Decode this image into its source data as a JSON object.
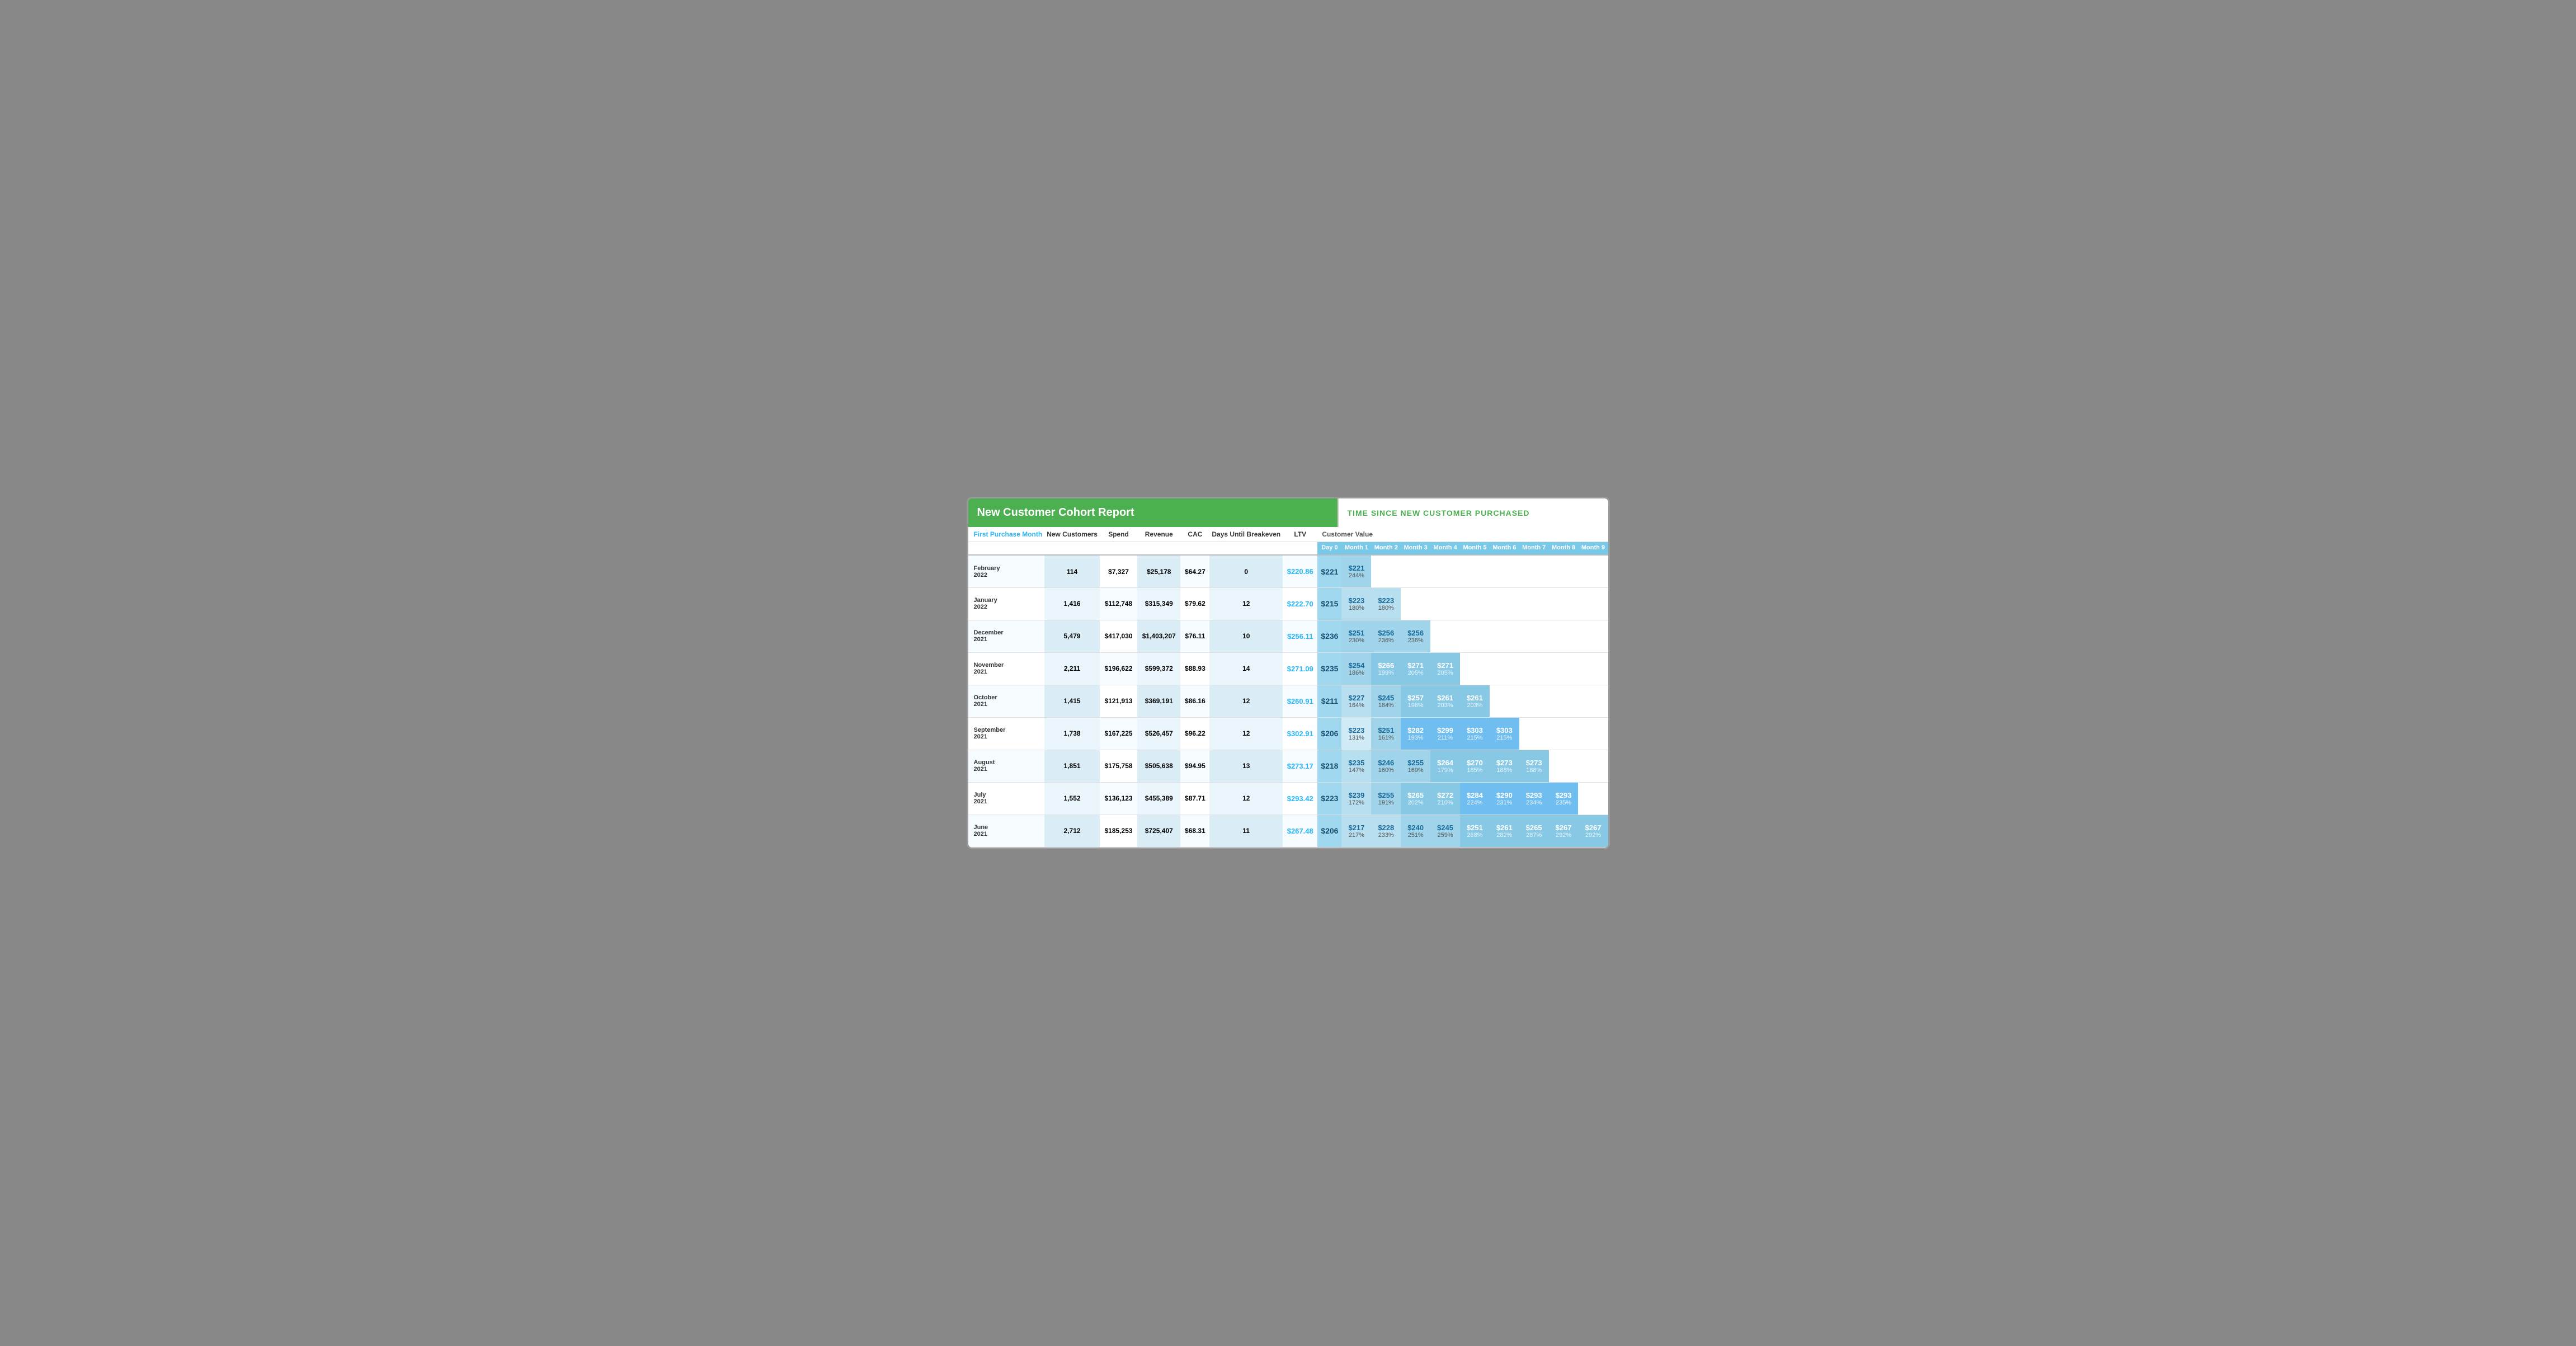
{
  "title": "New Customer Cohort Report",
  "time_header": "TIME SINCE NEW CUSTOMER PURCHASED",
  "col_headers": {
    "first_purchase": "First Purchase Month",
    "new_customers": "New Customers",
    "spend": "Spend",
    "revenue": "Revenue",
    "cac": "CAC",
    "days_until_breakeven": "Days Until Breakeven",
    "ltv": "LTV",
    "customer_value": "Customer Value",
    "day0": "Day 0",
    "month1": "Month 1",
    "month2": "Month 2",
    "month3": "Month 3",
    "month4": "Month 4",
    "month5": "Month 5",
    "month6": "Month 6",
    "month7": "Month 7",
    "month8": "Month 8",
    "month9": "Month 9"
  },
  "rows": [
    {
      "month": "February 2022",
      "new_customers": "114",
      "spend": "$7,327",
      "revenue": "$25,178",
      "cac": "$64.27",
      "days_breakeven": "0",
      "ltv": "$220.86",
      "day0": "$221",
      "cohort": [
        {
          "value": "$221",
          "pct": "244%",
          "diagonal": true,
          "intensity": 3
        },
        null,
        null,
        null,
        null,
        null,
        null,
        null,
        null
      ]
    },
    {
      "month": "January 2022",
      "new_customers": "1,416",
      "spend": "$112,748",
      "revenue": "$315,349",
      "cac": "$79.62",
      "days_breakeven": "12",
      "ltv": "$222.70",
      "day0": "$215",
      "cohort": [
        {
          "value": "$223",
          "pct": "180%",
          "diagonal": false,
          "intensity": 2
        },
        {
          "value": "$223",
          "pct": "180%",
          "diagonal": true,
          "intensity": 2
        },
        null,
        null,
        null,
        null,
        null,
        null,
        null
      ]
    },
    {
      "month": "December 2021",
      "new_customers": "5,479",
      "spend": "$417,030",
      "revenue": "$1,403,207",
      "cac": "$76.11",
      "days_breakeven": "10",
      "ltv": "$256.11",
      "day0": "$236",
      "cohort": [
        {
          "value": "$251",
          "pct": "230%",
          "diagonal": false,
          "intensity": 3
        },
        {
          "value": "$256",
          "pct": "236%",
          "diagonal": false,
          "intensity": 3
        },
        {
          "value": "$256",
          "pct": "236%",
          "diagonal": true,
          "intensity": 3
        },
        null,
        null,
        null,
        null,
        null,
        null
      ]
    },
    {
      "month": "November 2021",
      "new_customers": "2,211",
      "spend": "$196,622",
      "revenue": "$599,372",
      "cac": "$88.93",
      "days_breakeven": "14",
      "ltv": "$271.09",
      "day0": "$235",
      "cohort": [
        {
          "value": "$254",
          "pct": "186%",
          "diagonal": false,
          "intensity": 3
        },
        {
          "value": "$266",
          "pct": "199%",
          "diagonal": false,
          "intensity": 4
        },
        {
          "value": "$271",
          "pct": "205%",
          "diagonal": false,
          "intensity": 4
        },
        {
          "value": "$271",
          "pct": "205%",
          "diagonal": true,
          "intensity": 4
        },
        null,
        null,
        null,
        null,
        null
      ]
    },
    {
      "month": "October 2021",
      "new_customers": "1,415",
      "spend": "$121,913",
      "revenue": "$369,191",
      "cac": "$86.16",
      "days_breakeven": "12",
      "ltv": "$260.91",
      "day0": "$211",
      "cohort": [
        {
          "value": "$227",
          "pct": "164%",
          "diagonal": false,
          "intensity": 2
        },
        {
          "value": "$245",
          "pct": "184%",
          "diagonal": false,
          "intensity": 3
        },
        {
          "value": "$257",
          "pct": "198%",
          "diagonal": false,
          "intensity": 4
        },
        {
          "value": "$261",
          "pct": "203%",
          "diagonal": false,
          "intensity": 4
        },
        {
          "value": "$261",
          "pct": "203%",
          "diagonal": true,
          "intensity": 4
        },
        null,
        null,
        null,
        null
      ]
    },
    {
      "month": "September 2021",
      "new_customers": "1,738",
      "spend": "$167,225",
      "revenue": "$526,457",
      "cac": "$96.22",
      "days_breakeven": "12",
      "ltv": "$302.91",
      "day0": "$206",
      "cohort": [
        {
          "value": "$223",
          "pct": "131%",
          "diagonal": false,
          "intensity": 1
        },
        {
          "value": "$251",
          "pct": "161%",
          "diagonal": false,
          "intensity": 3
        },
        {
          "value": "$282",
          "pct": "193%",
          "diagonal": false,
          "intensity": 5
        },
        {
          "value": "$299",
          "pct": "211%",
          "diagonal": false,
          "intensity": 5
        },
        {
          "value": "$303",
          "pct": "215%",
          "diagonal": false,
          "intensity": 5
        },
        {
          "value": "$303",
          "pct": "215%",
          "diagonal": true,
          "intensity": 5
        },
        null,
        null,
        null
      ]
    },
    {
      "month": "August 2021",
      "new_customers": "1,851",
      "spend": "$175,758",
      "revenue": "$505,638",
      "cac": "$94.95",
      "days_breakeven": "13",
      "ltv": "$273.17",
      "day0": "$218",
      "cohort": [
        {
          "value": "$235",
          "pct": "147%",
          "diagonal": false,
          "intensity": 2
        },
        {
          "value": "$246",
          "pct": "160%",
          "diagonal": false,
          "intensity": 3
        },
        {
          "value": "$255",
          "pct": "169%",
          "diagonal": false,
          "intensity": 3
        },
        {
          "value": "$264",
          "pct": "179%",
          "diagonal": false,
          "intensity": 4
        },
        {
          "value": "$270",
          "pct": "185%",
          "diagonal": false,
          "intensity": 4
        },
        {
          "value": "$273",
          "pct": "188%",
          "diagonal": false,
          "intensity": 4
        },
        {
          "value": "$273",
          "pct": "188%",
          "diagonal": true,
          "intensity": 4
        },
        null,
        null
      ]
    },
    {
      "month": "July 2021",
      "new_customers": "1,552",
      "spend": "$136,123",
      "revenue": "$455,389",
      "cac": "$87.71",
      "days_breakeven": "12",
      "ltv": "$293.42",
      "day0": "$223",
      "cohort": [
        {
          "value": "$239",
          "pct": "172%",
          "diagonal": false,
          "intensity": 2
        },
        {
          "value": "$255",
          "pct": "191%",
          "diagonal": false,
          "intensity": 3
        },
        {
          "value": "$265",
          "pct": "202%",
          "diagonal": false,
          "intensity": 4
        },
        {
          "value": "$272",
          "pct": "210%",
          "diagonal": false,
          "intensity": 4
        },
        {
          "value": "$284",
          "pct": "224%",
          "diagonal": false,
          "intensity": 5
        },
        {
          "value": "$290",
          "pct": "231%",
          "diagonal": false,
          "intensity": 5
        },
        {
          "value": "$293",
          "pct": "234%",
          "diagonal": false,
          "intensity": 5
        },
        {
          "value": "$293",
          "pct": "235%",
          "diagonal": true,
          "intensity": 5
        },
        null
      ]
    },
    {
      "month": "June 2021",
      "new_customers": "2,712",
      "spend": "$185,253",
      "revenue": "$725,407",
      "cac": "$68.31",
      "days_breakeven": "11",
      "ltv": "$267.48",
      "day0": "$206",
      "cohort": [
        {
          "value": "$217",
          "pct": "217%",
          "diagonal": false,
          "intensity": 2
        },
        {
          "value": "$228",
          "pct": "233%",
          "diagonal": false,
          "intensity": 2
        },
        {
          "value": "$240",
          "pct": "251%",
          "diagonal": false,
          "intensity": 3
        },
        {
          "value": "$245",
          "pct": "259%",
          "diagonal": false,
          "intensity": 3
        },
        {
          "value": "$251",
          "pct": "268%",
          "diagonal": false,
          "intensity": 4
        },
        {
          "value": "$261",
          "pct": "282%",
          "diagonal": false,
          "intensity": 4
        },
        {
          "value": "$265",
          "pct": "287%",
          "diagonal": false,
          "intensity": 4
        },
        {
          "value": "$267",
          "pct": "292%",
          "diagonal": false,
          "intensity": 4
        },
        {
          "value": "$267",
          "pct": "292%",
          "diagonal": false,
          "intensity": 4
        }
      ]
    }
  ]
}
